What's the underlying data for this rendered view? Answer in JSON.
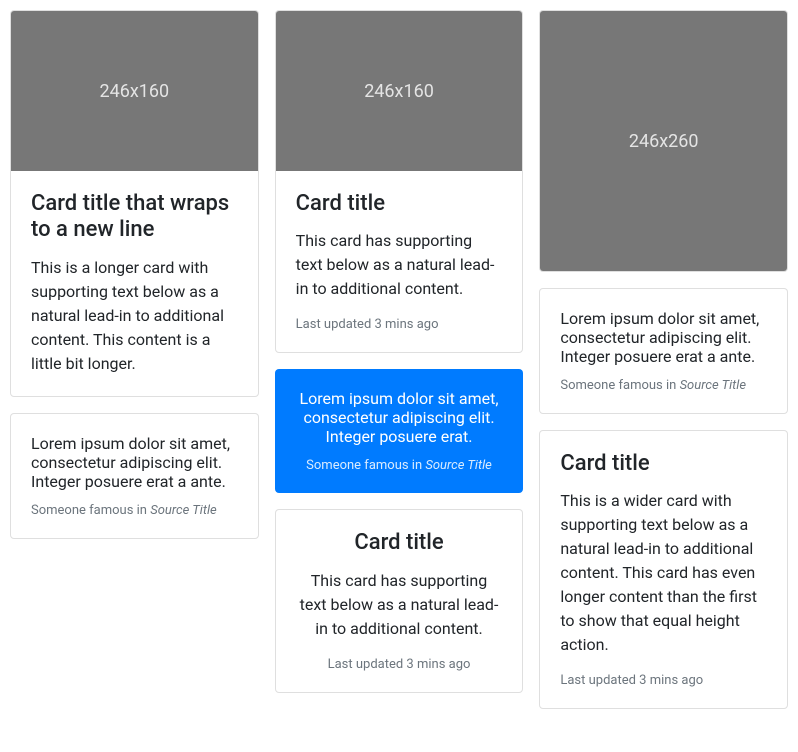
{
  "columns": [
    {
      "cards": [
        {
          "image": {
            "label": "246x160",
            "heightClass": "img-160"
          },
          "title": "Card title that wraps to a new line",
          "text": "This is a longer card with supporting text below as a natural lead-in to additional content. This content is a little bit longer."
        },
        {
          "quote": "Lorem ipsum dolor sit amet, consectetur adipiscing elit. Integer posuere erat a ante.",
          "attributionPrefix": "Someone famous in ",
          "source": "Source Title"
        }
      ]
    },
    {
      "cards": [
        {
          "image": {
            "label": "246x160",
            "heightClass": "img-160"
          },
          "title": "Card title",
          "text": "This card has supporting text below as a natural lead-in to additional content.",
          "footer": "Last updated 3 mins ago"
        },
        {
          "quote": "Lorem ipsum dolor sit amet, consectetur adipiscing elit. Integer posuere erat.",
          "attributionPrefix": "Someone famous in ",
          "source": "Source Title"
        },
        {
          "title": "Card title",
          "text": "This card has supporting text below as a natural lead-in to additional content.",
          "footer": "Last updated 3 mins ago"
        }
      ]
    },
    {
      "cards": [
        {
          "image": {
            "label": "246x260",
            "heightClass": "img-260"
          }
        },
        {
          "quote": "Lorem ipsum dolor sit amet, consectetur adipiscing elit. Integer posuere erat a ante.",
          "attributionPrefix": "Someone famous in ",
          "source": "Source Title"
        },
        {
          "title": "Card title",
          "text": "This is a wider card with supporting text below as a natural lead-in to additional content. This card has even longer content than the first to show that equal height action.",
          "footer": "Last updated 3 mins ago"
        }
      ]
    }
  ]
}
